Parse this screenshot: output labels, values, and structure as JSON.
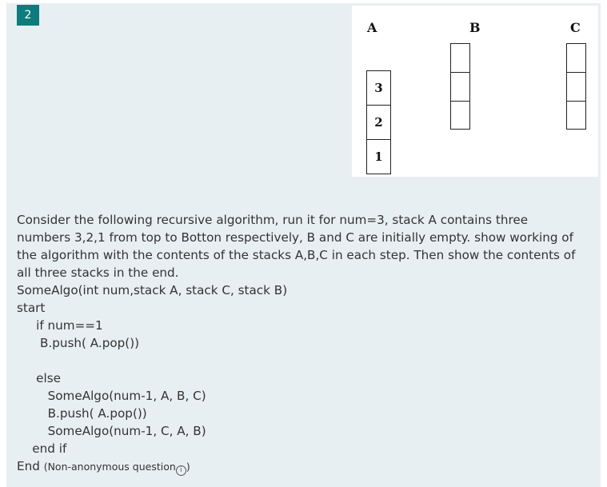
{
  "question": {
    "number": "2",
    "paragraph": "Consider the following recursive algorithm, run it for num=3, stack A contains three numbers 3,2,1 from top to Botton respectively, B and C are initially empty. show working of the algorithm with the contents of the stacks A,B,C in each step. Then show the contents of all three stacks in the end.",
    "code": [
      "SomeAlgo(int num,stack A, stack C, stack B)",
      "start",
      "     if num==1",
      "      B.push( A.pop())",
      "",
      "     else",
      "        SomeAlgo(num-1, A, B, C)",
      "        B.push( A.pop())",
      "        SomeAlgo(num-1, C, A, B)",
      "    end if"
    ],
    "end_word": "End",
    "meta": "(Non-anonymous question",
    "meta_close": ")"
  },
  "figure": {
    "labels": [
      "A",
      "B",
      "C"
    ],
    "stack_a": [
      "3",
      "2",
      "1"
    ],
    "stack_b": [
      "",
      "",
      ""
    ],
    "stack_c": [
      "",
      "",
      ""
    ]
  },
  "icons": {
    "info": "info-icon"
  },
  "colors": {
    "badge": "#0e7c7c",
    "panel": "#e8eff2"
  }
}
